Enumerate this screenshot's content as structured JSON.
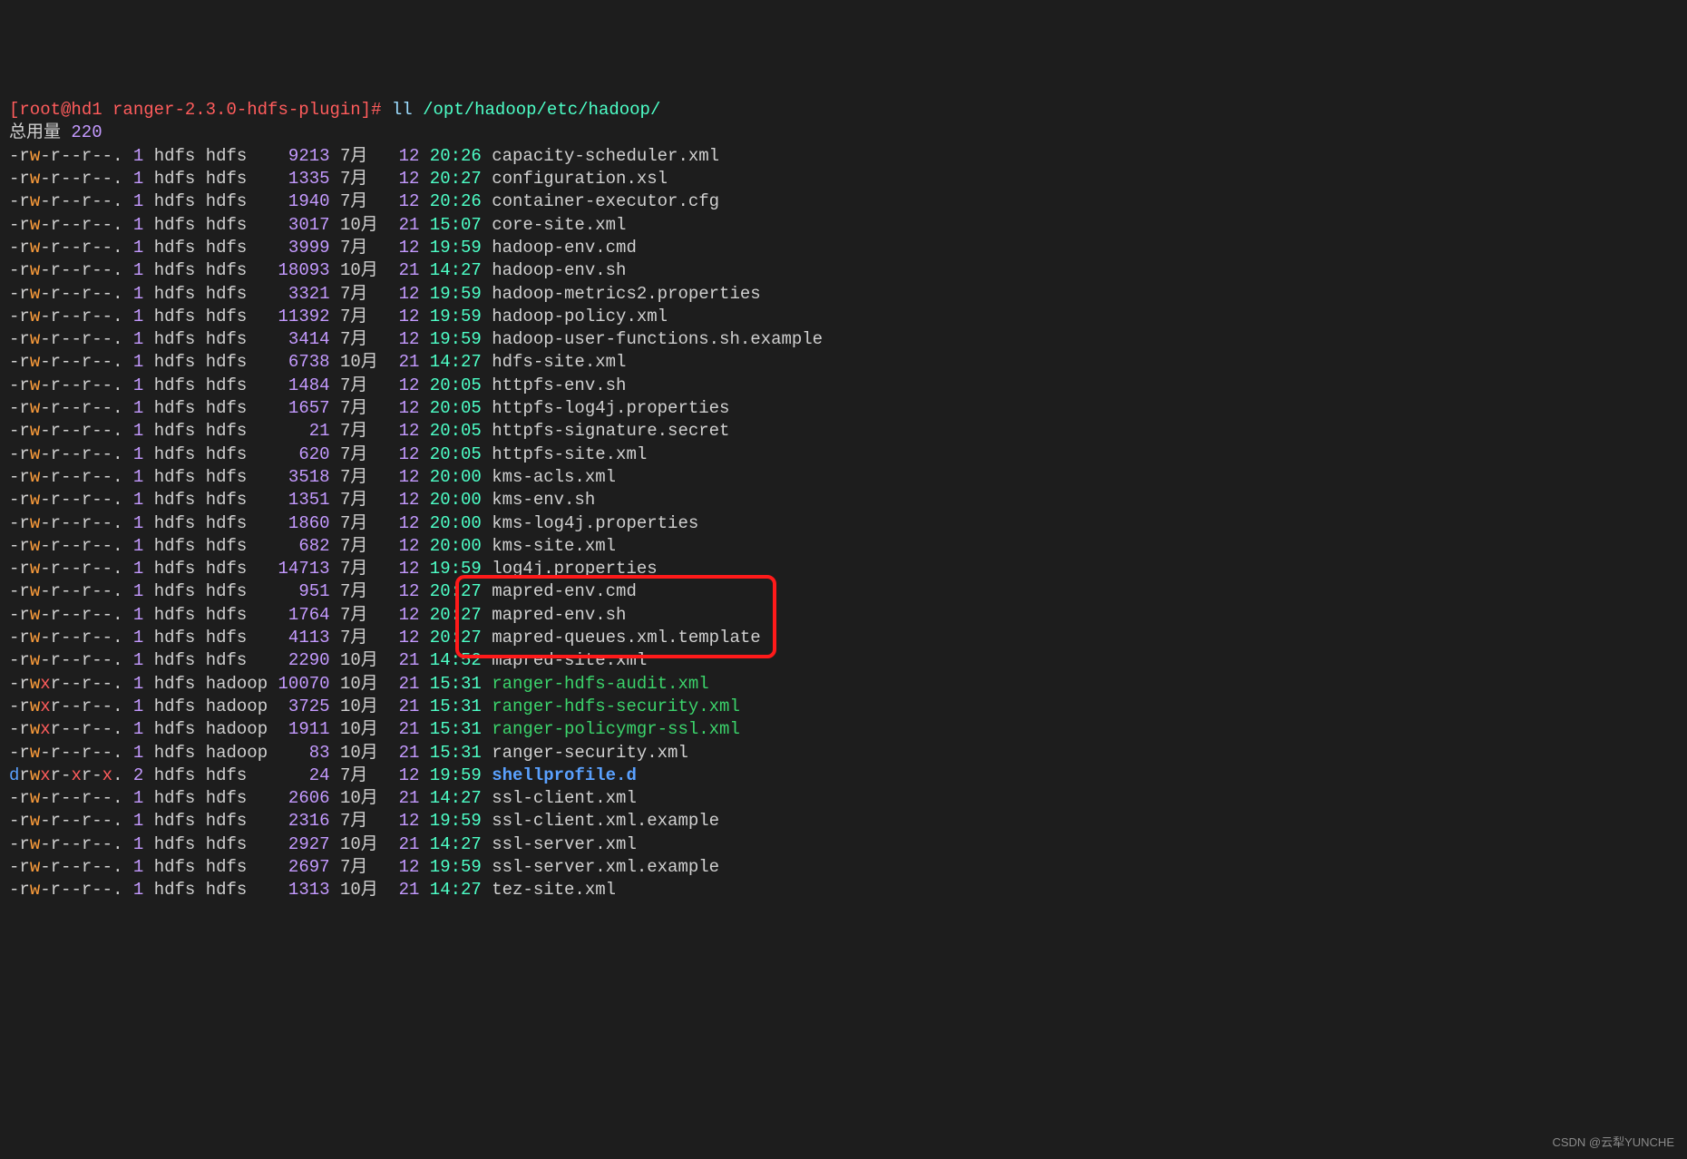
{
  "prompt": {
    "user": "root",
    "host": "hd1",
    "cwd": "ranger-2.3.0-hdfs-plugin",
    "symbol": "#",
    "command": "ll",
    "arg": "/opt/hadoop/etc/hadoop/"
  },
  "total_label": "总用量",
  "total_value": "220",
  "watermark": "CSDN @云犁YUNCHE",
  "files": [
    {
      "perms": "-rw-r--r--.",
      "links": "1",
      "owner": "hdfs",
      "group": "hdfs",
      "size": "9213",
      "month": "7月",
      "day": "12",
      "time": "20:26",
      "name": "capacity-scheduler.xml",
      "type": "file"
    },
    {
      "perms": "-rw-r--r--.",
      "links": "1",
      "owner": "hdfs",
      "group": "hdfs",
      "size": "1335",
      "month": "7月",
      "day": "12",
      "time": "20:27",
      "name": "configuration.xsl",
      "type": "file"
    },
    {
      "perms": "-rw-r--r--.",
      "links": "1",
      "owner": "hdfs",
      "group": "hdfs",
      "size": "1940",
      "month": "7月",
      "day": "12",
      "time": "20:26",
      "name": "container-executor.cfg",
      "type": "file"
    },
    {
      "perms": "-rw-r--r--.",
      "links": "1",
      "owner": "hdfs",
      "group": "hdfs",
      "size": "3017",
      "month": "10月",
      "day": "21",
      "time": "15:07",
      "name": "core-site.xml",
      "type": "file"
    },
    {
      "perms": "-rw-r--r--.",
      "links": "1",
      "owner": "hdfs",
      "group": "hdfs",
      "size": "3999",
      "month": "7月",
      "day": "12",
      "time": "19:59",
      "name": "hadoop-env.cmd",
      "type": "file"
    },
    {
      "perms": "-rw-r--r--.",
      "links": "1",
      "owner": "hdfs",
      "group": "hdfs",
      "size": "18093",
      "month": "10月",
      "day": "21",
      "time": "14:27",
      "name": "hadoop-env.sh",
      "type": "file"
    },
    {
      "perms": "-rw-r--r--.",
      "links": "1",
      "owner": "hdfs",
      "group": "hdfs",
      "size": "3321",
      "month": "7月",
      "day": "12",
      "time": "19:59",
      "name": "hadoop-metrics2.properties",
      "type": "file"
    },
    {
      "perms": "-rw-r--r--.",
      "links": "1",
      "owner": "hdfs",
      "group": "hdfs",
      "size": "11392",
      "month": "7月",
      "day": "12",
      "time": "19:59",
      "name": "hadoop-policy.xml",
      "type": "file"
    },
    {
      "perms": "-rw-r--r--.",
      "links": "1",
      "owner": "hdfs",
      "group": "hdfs",
      "size": "3414",
      "month": "7月",
      "day": "12",
      "time": "19:59",
      "name": "hadoop-user-functions.sh.example",
      "type": "file"
    },
    {
      "perms": "-rw-r--r--.",
      "links": "1",
      "owner": "hdfs",
      "group": "hdfs",
      "size": "6738",
      "month": "10月",
      "day": "21",
      "time": "14:27",
      "name": "hdfs-site.xml",
      "type": "file"
    },
    {
      "perms": "-rw-r--r--.",
      "links": "1",
      "owner": "hdfs",
      "group": "hdfs",
      "size": "1484",
      "month": "7月",
      "day": "12",
      "time": "20:05",
      "name": "httpfs-env.sh",
      "type": "file"
    },
    {
      "perms": "-rw-r--r--.",
      "links": "1",
      "owner": "hdfs",
      "group": "hdfs",
      "size": "1657",
      "month": "7月",
      "day": "12",
      "time": "20:05",
      "name": "httpfs-log4j.properties",
      "type": "file"
    },
    {
      "perms": "-rw-r--r--.",
      "links": "1",
      "owner": "hdfs",
      "group": "hdfs",
      "size": "21",
      "month": "7月",
      "day": "12",
      "time": "20:05",
      "name": "httpfs-signature.secret",
      "type": "file"
    },
    {
      "perms": "-rw-r--r--.",
      "links": "1",
      "owner": "hdfs",
      "group": "hdfs",
      "size": "620",
      "month": "7月",
      "day": "12",
      "time": "20:05",
      "name": "httpfs-site.xml",
      "type": "file"
    },
    {
      "perms": "-rw-r--r--.",
      "links": "1",
      "owner": "hdfs",
      "group": "hdfs",
      "size": "3518",
      "month": "7月",
      "day": "12",
      "time": "20:00",
      "name": "kms-acls.xml",
      "type": "file"
    },
    {
      "perms": "-rw-r--r--.",
      "links": "1",
      "owner": "hdfs",
      "group": "hdfs",
      "size": "1351",
      "month": "7月",
      "day": "12",
      "time": "20:00",
      "name": "kms-env.sh",
      "type": "file"
    },
    {
      "perms": "-rw-r--r--.",
      "links": "1",
      "owner": "hdfs",
      "group": "hdfs",
      "size": "1860",
      "month": "7月",
      "day": "12",
      "time": "20:00",
      "name": "kms-log4j.properties",
      "type": "file"
    },
    {
      "perms": "-rw-r--r--.",
      "links": "1",
      "owner": "hdfs",
      "group": "hdfs",
      "size": "682",
      "month": "7月",
      "day": "12",
      "time": "20:00",
      "name": "kms-site.xml",
      "type": "file"
    },
    {
      "perms": "-rw-r--r--.",
      "links": "1",
      "owner": "hdfs",
      "group": "hdfs",
      "size": "14713",
      "month": "7月",
      "day": "12",
      "time": "19:59",
      "name": "log4j.properties",
      "type": "file"
    },
    {
      "perms": "-rw-r--r--.",
      "links": "1",
      "owner": "hdfs",
      "group": "hdfs",
      "size": "951",
      "month": "7月",
      "day": "12",
      "time": "20:27",
      "name": "mapred-env.cmd",
      "type": "file"
    },
    {
      "perms": "-rw-r--r--.",
      "links": "1",
      "owner": "hdfs",
      "group": "hdfs",
      "size": "1764",
      "month": "7月",
      "day": "12",
      "time": "20:27",
      "name": "mapred-env.sh",
      "type": "file"
    },
    {
      "perms": "-rw-r--r--.",
      "links": "1",
      "owner": "hdfs",
      "group": "hdfs",
      "size": "4113",
      "month": "7月",
      "day": "12",
      "time": "20:27",
      "name": "mapred-queues.xml.template",
      "type": "file"
    },
    {
      "perms": "-rw-r--r--.",
      "links": "1",
      "owner": "hdfs",
      "group": "hdfs",
      "size": "2290",
      "month": "10月",
      "day": "21",
      "time": "14:52",
      "name": "mapred-site.xml",
      "type": "file"
    },
    {
      "perms": "-rwxr--r--.",
      "links": "1",
      "owner": "hdfs",
      "group": "hadoop",
      "size": "10070",
      "month": "10月",
      "day": "21",
      "time": "15:31",
      "name": "ranger-hdfs-audit.xml",
      "type": "exec"
    },
    {
      "perms": "-rwxr--r--.",
      "links": "1",
      "owner": "hdfs",
      "group": "hadoop",
      "size": "3725",
      "month": "10月",
      "day": "21",
      "time": "15:31",
      "name": "ranger-hdfs-security.xml",
      "type": "exec"
    },
    {
      "perms": "-rwxr--r--.",
      "links": "1",
      "owner": "hdfs",
      "group": "hadoop",
      "size": "1911",
      "month": "10月",
      "day": "21",
      "time": "15:31",
      "name": "ranger-policymgr-ssl.xml",
      "type": "exec"
    },
    {
      "perms": "-rw-r--r--.",
      "links": "1",
      "owner": "hdfs",
      "group": "hadoop",
      "size": "83",
      "month": "10月",
      "day": "21",
      "time": "15:31",
      "name": "ranger-security.xml",
      "type": "file"
    },
    {
      "perms": "drwxr-xr-x.",
      "links": "2",
      "owner": "hdfs",
      "group": "hdfs",
      "size": "24",
      "month": "7月",
      "day": "12",
      "time": "19:59",
      "name": "shellprofile.d",
      "type": "dir"
    },
    {
      "perms": "-rw-r--r--.",
      "links": "1",
      "owner": "hdfs",
      "group": "hdfs",
      "size": "2606",
      "month": "10月",
      "day": "21",
      "time": "14:27",
      "name": "ssl-client.xml",
      "type": "file"
    },
    {
      "perms": "-rw-r--r--.",
      "links": "1",
      "owner": "hdfs",
      "group": "hdfs",
      "size": "2316",
      "month": "7月",
      "day": "12",
      "time": "19:59",
      "name": "ssl-client.xml.example",
      "type": "file"
    },
    {
      "perms": "-rw-r--r--.",
      "links": "1",
      "owner": "hdfs",
      "group": "hdfs",
      "size": "2927",
      "month": "10月",
      "day": "21",
      "time": "14:27",
      "name": "ssl-server.xml",
      "type": "file"
    },
    {
      "perms": "-rw-r--r--.",
      "links": "1",
      "owner": "hdfs",
      "group": "hdfs",
      "size": "2697",
      "month": "7月",
      "day": "12",
      "time": "19:59",
      "name": "ssl-server.xml.example",
      "type": "file"
    },
    {
      "perms": "-rw-r--r--.",
      "links": "1",
      "owner": "hdfs",
      "group": "hdfs",
      "size": "1313",
      "month": "10月",
      "day": "21",
      "time": "14:27",
      "name": "tez-site.xml",
      "type": "file"
    }
  ]
}
